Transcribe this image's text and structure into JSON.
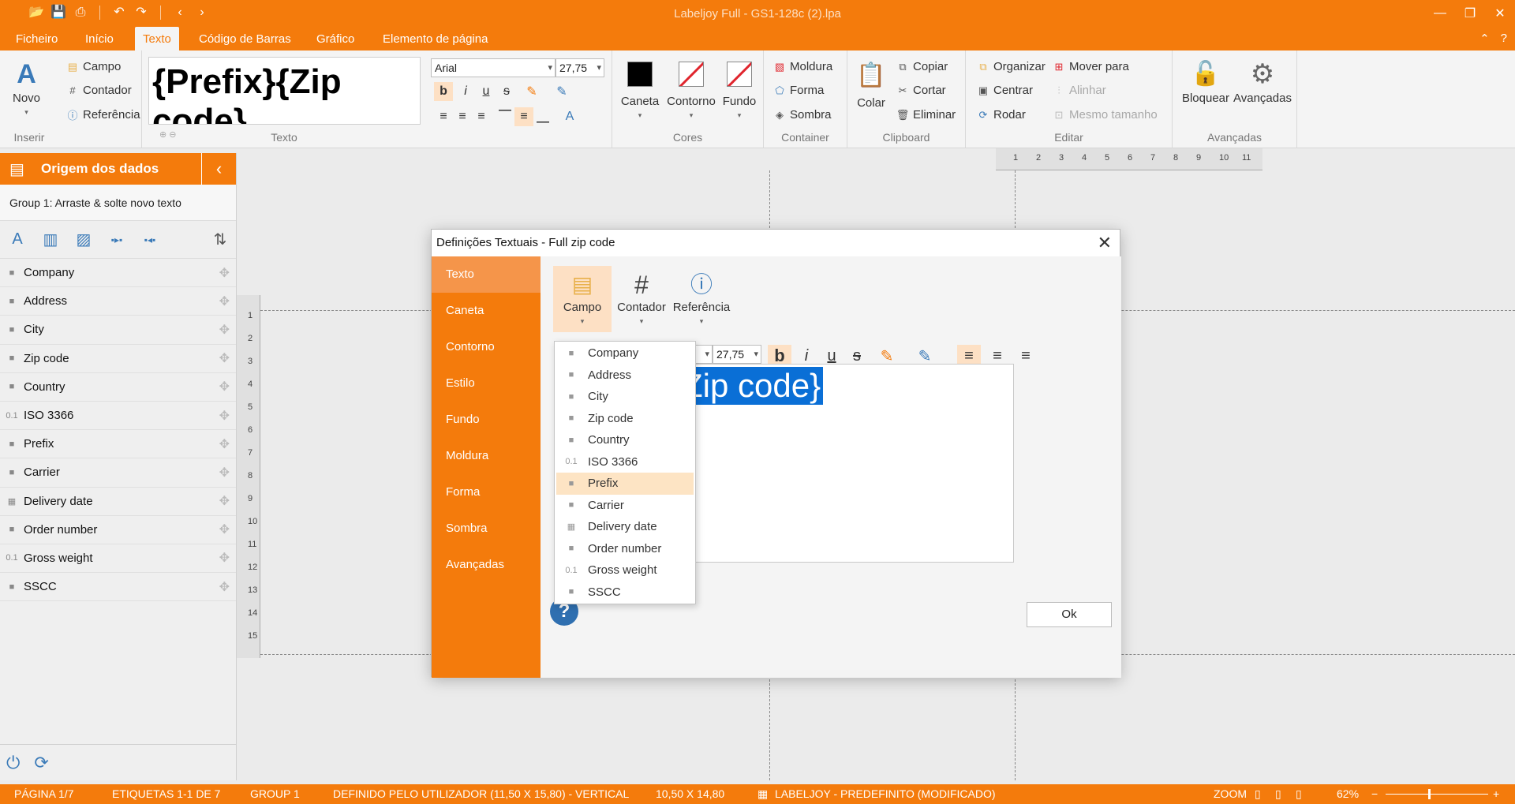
{
  "window": {
    "title": "Labeljoy Full - GS1-128c (2).lpa"
  },
  "menu": {
    "tabs": [
      "Ficheiro",
      "Início",
      "Texto",
      "Código de Barras",
      "Gráfico",
      "Elemento de página"
    ]
  },
  "ribbon": {
    "inserir": {
      "novo": "Novo",
      "campo": "Campo",
      "contador": "Contador",
      "referencia": "Referência",
      "label": "Inserir"
    },
    "texto": {
      "preview": "{Prefix}{Zip code}",
      "label": "Texto",
      "font": "Arial",
      "size": "27,75"
    },
    "cores": {
      "caneta": "Caneta",
      "contorno": "Contorno",
      "fundo": "Fundo",
      "label": "Cores"
    },
    "container": {
      "moldura": "Moldura",
      "forma": "Forma",
      "sombra": "Sombra",
      "label": "Container"
    },
    "clipboard": {
      "colar": "Colar",
      "copiar": "Copiar",
      "cortar": "Cortar",
      "eliminar": "Eliminar",
      "label": "Clipboard"
    },
    "editar": {
      "organizar": "Organizar",
      "centrar": "Centrar",
      "rodar": "Rodar",
      "mover": "Mover para",
      "alinhar": "Alinhar",
      "mesmo": "Mesmo tamanho",
      "label": "Editar"
    },
    "avancadas": {
      "bloquear": "Bloquear",
      "avancadas": "Avançadas",
      "label": "Avançadas"
    }
  },
  "left_panel": {
    "title": "Origem dos dados",
    "group": "Group 1: Arraste & solte novo texto",
    "fields": [
      {
        "name": "Company",
        "icon": "■"
      },
      {
        "name": "Address",
        "icon": "■"
      },
      {
        "name": "City",
        "icon": "■"
      },
      {
        "name": "Zip code",
        "icon": "■"
      },
      {
        "name": "Country",
        "icon": "■"
      },
      {
        "name": "ISO 3366",
        "icon": "0.1"
      },
      {
        "name": "Prefix",
        "icon": "■"
      },
      {
        "name": "Carrier",
        "icon": "■"
      },
      {
        "name": "Delivery date",
        "icon": "▦"
      },
      {
        "name": "Order number",
        "icon": "■"
      },
      {
        "name": "Gross weight",
        "icon": "0.1"
      },
      {
        "name": "SSCC",
        "icon": "■"
      }
    ]
  },
  "rulers": {
    "h": [
      "1",
      "2",
      "3",
      "4",
      "5",
      "6",
      "7",
      "8",
      "9",
      "10",
      "11"
    ],
    "v": [
      "1",
      "2",
      "3",
      "4",
      "5",
      "6",
      "7",
      "8",
      "9",
      "10",
      "11",
      "12",
      "13",
      "14",
      "15"
    ]
  },
  "dialog": {
    "title": "Definições Textuais - Full zip code",
    "nav": [
      "Texto",
      "Caneta",
      "Contorno",
      "Estilo",
      "Fundo",
      "Moldura",
      "Forma",
      "Sombra",
      "Avançadas"
    ],
    "campo": "Campo",
    "contador": "Contador",
    "referencia": "Referência",
    "size": "27,75",
    "selected_text": "{Zip code}",
    "ok": "Ok",
    "dropdown": [
      {
        "name": "Company",
        "icon": "■"
      },
      {
        "name": "Address",
        "icon": "■"
      },
      {
        "name": "City",
        "icon": "■"
      },
      {
        "name": "Zip code",
        "icon": "■"
      },
      {
        "name": "Country",
        "icon": "■"
      },
      {
        "name": "ISO 3366",
        "icon": "0.1"
      },
      {
        "name": "Prefix",
        "icon": "■"
      },
      {
        "name": "Carrier",
        "icon": "■"
      },
      {
        "name": "Delivery date",
        "icon": "▦"
      },
      {
        "name": "Order number",
        "icon": "■"
      },
      {
        "name": "Gross weight",
        "icon": "0.1"
      },
      {
        "name": "SSCC",
        "icon": "■"
      }
    ],
    "highlighted": "Prefix"
  },
  "status": {
    "pagina": "PÁGINA 1/7",
    "etiquetas": "ETIQUETAS 1-1 DE 7",
    "group": "GROUP 1",
    "definido": "DEFINIDO PELO UTILIZADOR (11,50 X 15,80) - VERTICAL",
    "size": "10,50 X 14,80",
    "preset": "LABELJOY - PREDEFINITO (MODIFICADO)",
    "zoom_label": "ZOOM",
    "zoom": "62%"
  },
  "colors": {
    "accent": "#f47b0c",
    "selection": "#0a6fd6"
  }
}
